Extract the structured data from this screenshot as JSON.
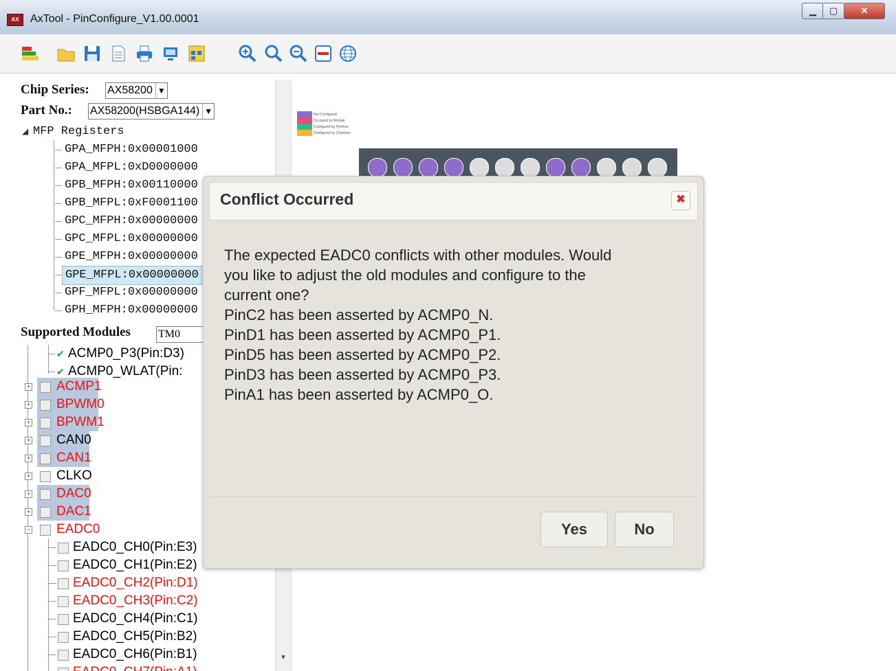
{
  "window": {
    "title": "AxTool - PinConfigure_V1.00.0001",
    "app_badge": "AX"
  },
  "window_controls": {
    "minimize": "▁",
    "maximize": "▢",
    "close": "✕"
  },
  "toolbar": {
    "icons": [
      "bar-chart-icon",
      "open-folder-icon",
      "save-icon",
      "document-icon",
      "print-icon",
      "monitor-icon",
      "report-icon",
      "zoom-in-icon",
      "zoom-reset-icon",
      "zoom-out-icon",
      "minimize-panel-icon",
      "globe-icon"
    ]
  },
  "left": {
    "chip_series_label": "Chip Series:",
    "chip_series_value": "AX58200",
    "part_no_label": "Part No.:",
    "part_no_value": "AX58200(HSBGA144)",
    "mfp_root": "MFP Registers",
    "registers": [
      "GPA_MFPH:0x00001000",
      "GPA_MFPL:0xD0000000",
      "GPB_MFPH:0x00110000",
      "GPB_MFPL:0xF0001100",
      "GPC_MFPH:0x00000000",
      "GPC_MFPL:0x00000000",
      "GPE_MFPH:0x00000000",
      "GPE_MFPL:0x00000000",
      "GPF_MFPL:0x00000000",
      "GPH_MFPH:0x00000000"
    ],
    "supported_label": "Supported Modules",
    "supported_filter": "TM0",
    "acmp_children": [
      "ACMP0_P3(Pin:D3)",
      "ACMP0_WLAT(Pin:"
    ],
    "modules": [
      "ACMP1",
      "BPWM0",
      "BPWM1",
      "CAN0",
      "CAN1",
      "CLKO",
      "DAC0",
      "DAC1",
      "EADC0"
    ],
    "eadc_children": [
      "EADC0_CH0(Pin:E3)",
      "EADC0_CH1(Pin:E2)",
      "EADC0_CH2(Pin:D1)",
      "EADC0_CH3(Pin:C2)",
      "EADC0_CH4(Pin:C1)",
      "EADC0_CH5(Pin:B2)",
      "EADC0_CH6(Pin:B1)",
      "EADC0_CH7(Pin:A1)"
    ]
  },
  "preview": {
    "legend": [
      "Not Configured",
      "Occupied by Module",
      "Configured by PinView",
      "Configured by ChipView"
    ],
    "legend_colors": [
      "#8e6cc9",
      "#e2507a",
      "#3db58a",
      "#f2b43a"
    ]
  },
  "dialog": {
    "title": "Conflict Occurred",
    "close_symbol": "✖",
    "message_lines": [
      "The expected EADC0 conflicts with other modules. Would",
      "you like to adjust the old modules and configure to the",
      "current one?",
      "PinC2 has been asserted by ACMP0_N.",
      "PinD1 has been asserted by ACMP0_P1.",
      "PinD5 has been asserted by ACMP0_P2.",
      "PinD3 has been asserted by ACMP0_P3.",
      "PinA1 has been asserted by ACMP0_O."
    ],
    "yes": "Yes",
    "no": "No"
  }
}
